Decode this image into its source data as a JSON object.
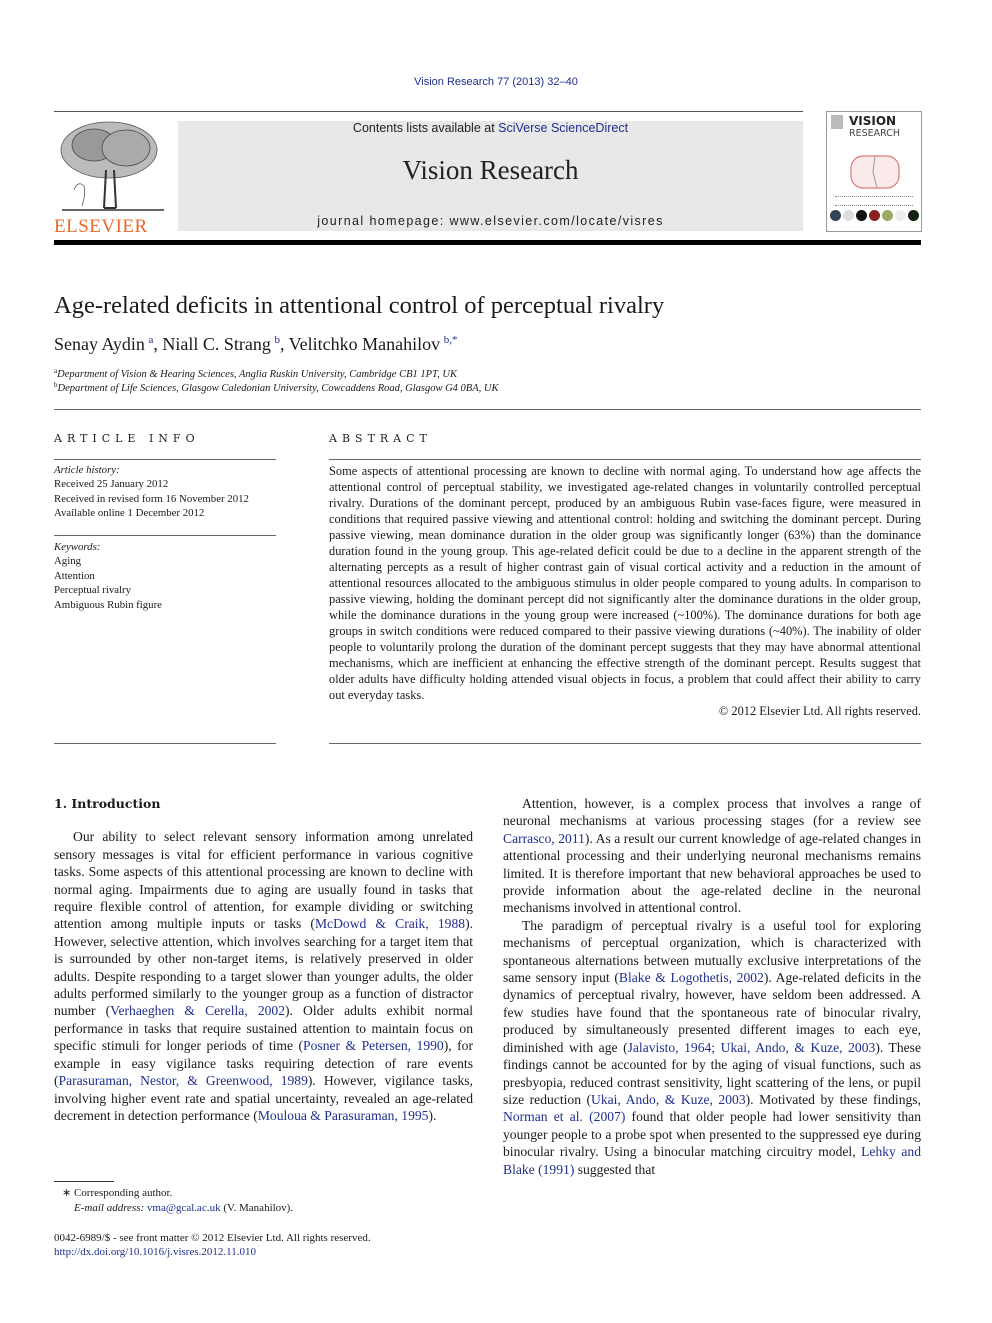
{
  "running_head": "Vision Research 77 (2013) 32–40",
  "masthead": {
    "publisher": "ELSEVIER",
    "contents_prefix": "Contents lists available at ",
    "contents_link": "SciVerse ScienceDirect",
    "journal_title": "Vision Research",
    "homepage": "journal homepage: www.elsevier.com/locate/visres",
    "cover_title_line1": "VISION",
    "cover_title_line2": "RESEARCH"
  },
  "article": {
    "title": "Age-related deficits in attentional control of perceptual rivalry",
    "authors": [
      {
        "name": "Senay Aydin",
        "sup": "a",
        "sep": ", "
      },
      {
        "name": "Niall C. Strang",
        "sup": "b",
        "sep": ", "
      },
      {
        "name": "Velitchko Manahilov",
        "sup": "b,*",
        "sep": ""
      }
    ],
    "affiliations": [
      {
        "sup": "a",
        "text": "Department of Vision & Hearing Sciences, Anglia Ruskin University, Cambridge CB1 1PT, UK"
      },
      {
        "sup": "b",
        "text": "Department of Life Sciences, Glasgow Caledonian University, Cowcaddens Road, Glasgow G4 0BA, UK"
      }
    ]
  },
  "article_info": {
    "heading": "ARTICLE INFO",
    "history_label": "Article history:",
    "history": [
      "Received 25 January 2012",
      "Received in revised form 16 November 2012",
      "Available online 1 December 2012"
    ],
    "keywords_label": "Keywords:",
    "keywords": [
      "Aging",
      "Attention",
      "Perceptual rivalry",
      "Ambiguous Rubin figure"
    ]
  },
  "abstract": {
    "heading": "ABSTRACT",
    "text": "Some aspects of attentional processing are known to decline with normal aging. To understand how age affects the attentional control of perceptual stability, we investigated age-related changes in voluntarily controlled perceptual rivalry. Durations of the dominant percept, produced by an ambiguous Rubin vase-faces figure, were measured in conditions that required passive viewing and attentional control: holding and switching the dominant percept. During passive viewing, mean dominance duration in the older group was significantly longer (63%) than the dominance duration found in the young group. This age-related deficit could be due to a decline in the apparent strength of the alternating percepts as a result of higher contrast gain of visual cortical activity and a reduction in the amount of attentional resources allocated to the ambiguous stimulus in older people compared to young adults. In comparison to passive viewing, holding the dominant percept did not significantly alter the dominance durations in the older group, while the dominance durations in the young group were increased (~100%). The dominance durations for both age groups in switch conditions were reduced compared to their passive viewing durations (~40%). The inability of older people to voluntarily prolong the duration of the dominant percept suggests that they may have abnormal attentional mechanisms, which are inefficient at enhancing the effective strength of the dominant percept. Results suggest that older adults have difficulty holding attended visual objects in focus, a problem that could affect their ability to carry out everyday tasks.",
    "copyright": "© 2012 Elsevier Ltd. All rights reserved."
  },
  "intro": {
    "heading": "1. Introduction",
    "p1": [
      {
        "t": "Our ability to select relevant sensory information among unrelated sensory messages is vital for efficient performance in various cognitive tasks. Some aspects of this attentional processing are known to decline with normal aging. Impairments due to aging are usually found in tasks that require flexible control of attention, for example dividing or switching attention among multiple inputs or tasks ("
      },
      {
        "l": "McDowd & Craik, 1988"
      },
      {
        "t": "). However, selective attention, which involves searching for a target item that is surrounded by other non-target items, is relatively preserved in older adults. Despite responding to a target slower than younger adults, the older adults performed similarly to the younger group as a function of distractor number ("
      },
      {
        "l": "Verhaeghen & Cerella, 2002"
      },
      {
        "t": "). Older adults exhibit normal performance in tasks that require sustained attention to maintain focus on specific stimuli for longer periods of time ("
      },
      {
        "l": "Posner & Petersen, 1990"
      },
      {
        "t": "), for example in easy vigilance tasks requiring detection of rare events ("
      },
      {
        "l": "Parasuraman, Nestor, & Greenwood, 1989"
      },
      {
        "t": "). However, vigilance tasks, involving higher event rate and spatial uncertainty, revealed an age-related decrement in detection performance ("
      },
      {
        "l": "Mouloua & Parasuraman, 1995"
      },
      {
        "t": ")."
      }
    ],
    "p2": [
      {
        "t": "Attention, however, is a complex process that involves a range of neuronal mechanisms at various processing stages (for a review see "
      },
      {
        "l": "Carrasco, 2011"
      },
      {
        "t": "). As a result our current knowledge of age-related changes in attentional processing and their underlying neuronal mechanisms remains limited. It is therefore important that new behavioral approaches be used to provide information about the age-related decline in the neuronal mechanisms involved in attentional control."
      }
    ],
    "p3": [
      {
        "t": "The paradigm of perceptual rivalry is a useful tool for exploring mechanisms of perceptual organization, which is characterized with spontaneous alternations between mutually exclusive interpretations of the same sensory input ("
      },
      {
        "l": "Blake & Logothetis, 2002"
      },
      {
        "t": "). Age-related deficits in the dynamics of perceptual rivalry, however, have seldom been addressed. A few studies have found that the spontaneous rate of binocular rivalry, produced by simultaneously presented different images to each eye, diminished with age ("
      },
      {
        "l": "Jalavisto, 1964; Ukai, Ando, & Kuze, 2003"
      },
      {
        "t": "). These findings cannot be accounted for by the aging of visual functions, such as presbyopia, reduced contrast sensitivity, light scattering of the lens, or pupil size reduction ("
      },
      {
        "l": "Ukai, Ando, & Kuze, 2003"
      },
      {
        "t": "). Motivated by these findings, "
      },
      {
        "l": "Norman et al. (2007)"
      },
      {
        "t": " found that older people had lower sensitivity than younger people to a probe spot when presented to the suppressed eye during binocular rivalry. Using a binocular matching circuitry model, "
      },
      {
        "l": "Lehky and Blake (1991)"
      },
      {
        "t": " suggested that"
      }
    ]
  },
  "footnotes": {
    "corresponding": "Corresponding author.",
    "email_label": "E-mail address:",
    "email": "vma@gcal.ac.uk",
    "email_owner": "(V. Manahilov).",
    "front_matter": "0042-6989/$ - see front matter © 2012 Elsevier Ltd. All rights reserved.",
    "doi": "http://dx.doi.org/10.1016/j.visres.2012.11.010"
  },
  "colors": {
    "link": "#1f2f8f",
    "elsevier_orange": "#e8692a",
    "banner_bg": "#e8e8e8"
  }
}
